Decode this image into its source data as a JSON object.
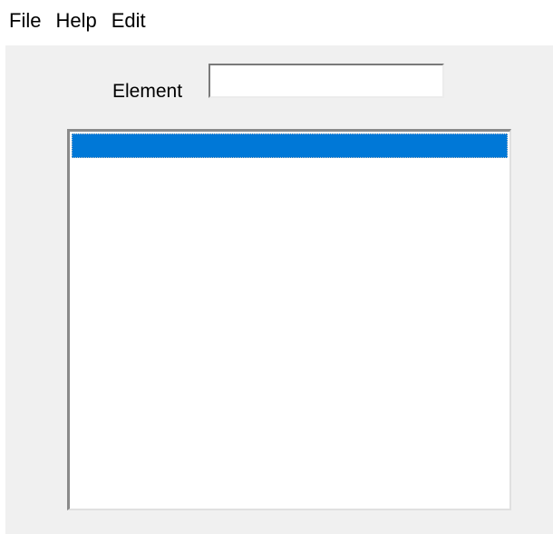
{
  "menubar": {
    "items": [
      {
        "label": "File"
      },
      {
        "label": "Help"
      },
      {
        "label": "Edit"
      }
    ]
  },
  "form": {
    "element_label": "Element",
    "element_value": ""
  },
  "listbox": {
    "items": [
      {
        "text": "",
        "selected": true
      }
    ]
  },
  "colors": {
    "selection": "#0078d7",
    "client_background": "#f0f0f0"
  }
}
